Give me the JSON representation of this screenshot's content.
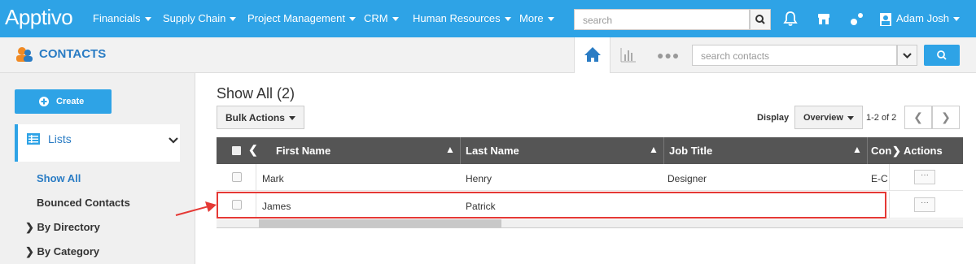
{
  "brand": {
    "logo": "Apptivo",
    "accent": "#2ea3e6"
  },
  "top_nav": {
    "items": [
      "Financials",
      "Supply Chain",
      "Project Management",
      "CRM",
      "Human Resources",
      "More"
    ],
    "search_placeholder": "search",
    "user_name": "Adam Josh"
  },
  "app_bar": {
    "title": "CONTACTS",
    "search_placeholder": "search contacts"
  },
  "sidebar": {
    "create_label": "Create",
    "lists_label": "Lists",
    "show_all": "Show All",
    "bounced": "Bounced Contacts",
    "by_directory": "By Directory",
    "by_category": "By Category"
  },
  "main": {
    "title": "Show All (2)",
    "bulk_actions": "Bulk Actions",
    "display_label": "Display",
    "display_value": "Overview",
    "count": "1-2 of 2"
  },
  "table": {
    "headers": {
      "first_name": "First Name",
      "last_name": "Last Name",
      "job_title": "Job Title",
      "company": "Con",
      "actions": "Actions"
    },
    "rows": [
      {
        "first_name": "Mark",
        "last_name": "Henry",
        "job_title": "Designer",
        "company": "E-C",
        "actions": "···"
      },
      {
        "first_name": "James",
        "last_name": "Patrick",
        "job_title": "",
        "company": "",
        "actions": "···"
      }
    ]
  },
  "annotation_color": "#e53935"
}
